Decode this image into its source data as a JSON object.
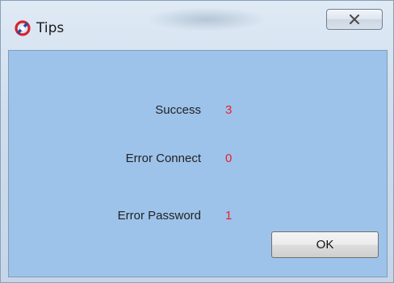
{
  "window": {
    "title": "Tips",
    "close_label": "✕"
  },
  "results": [
    {
      "label": "Success",
      "value": "3"
    },
    {
      "label": "Error Connect",
      "value": "0"
    },
    {
      "label": "Error Password",
      "value": "1"
    }
  ],
  "ok_label": "OK",
  "colors": {
    "client_bg": "#9dc3ea",
    "value_red": "#e8202a"
  }
}
